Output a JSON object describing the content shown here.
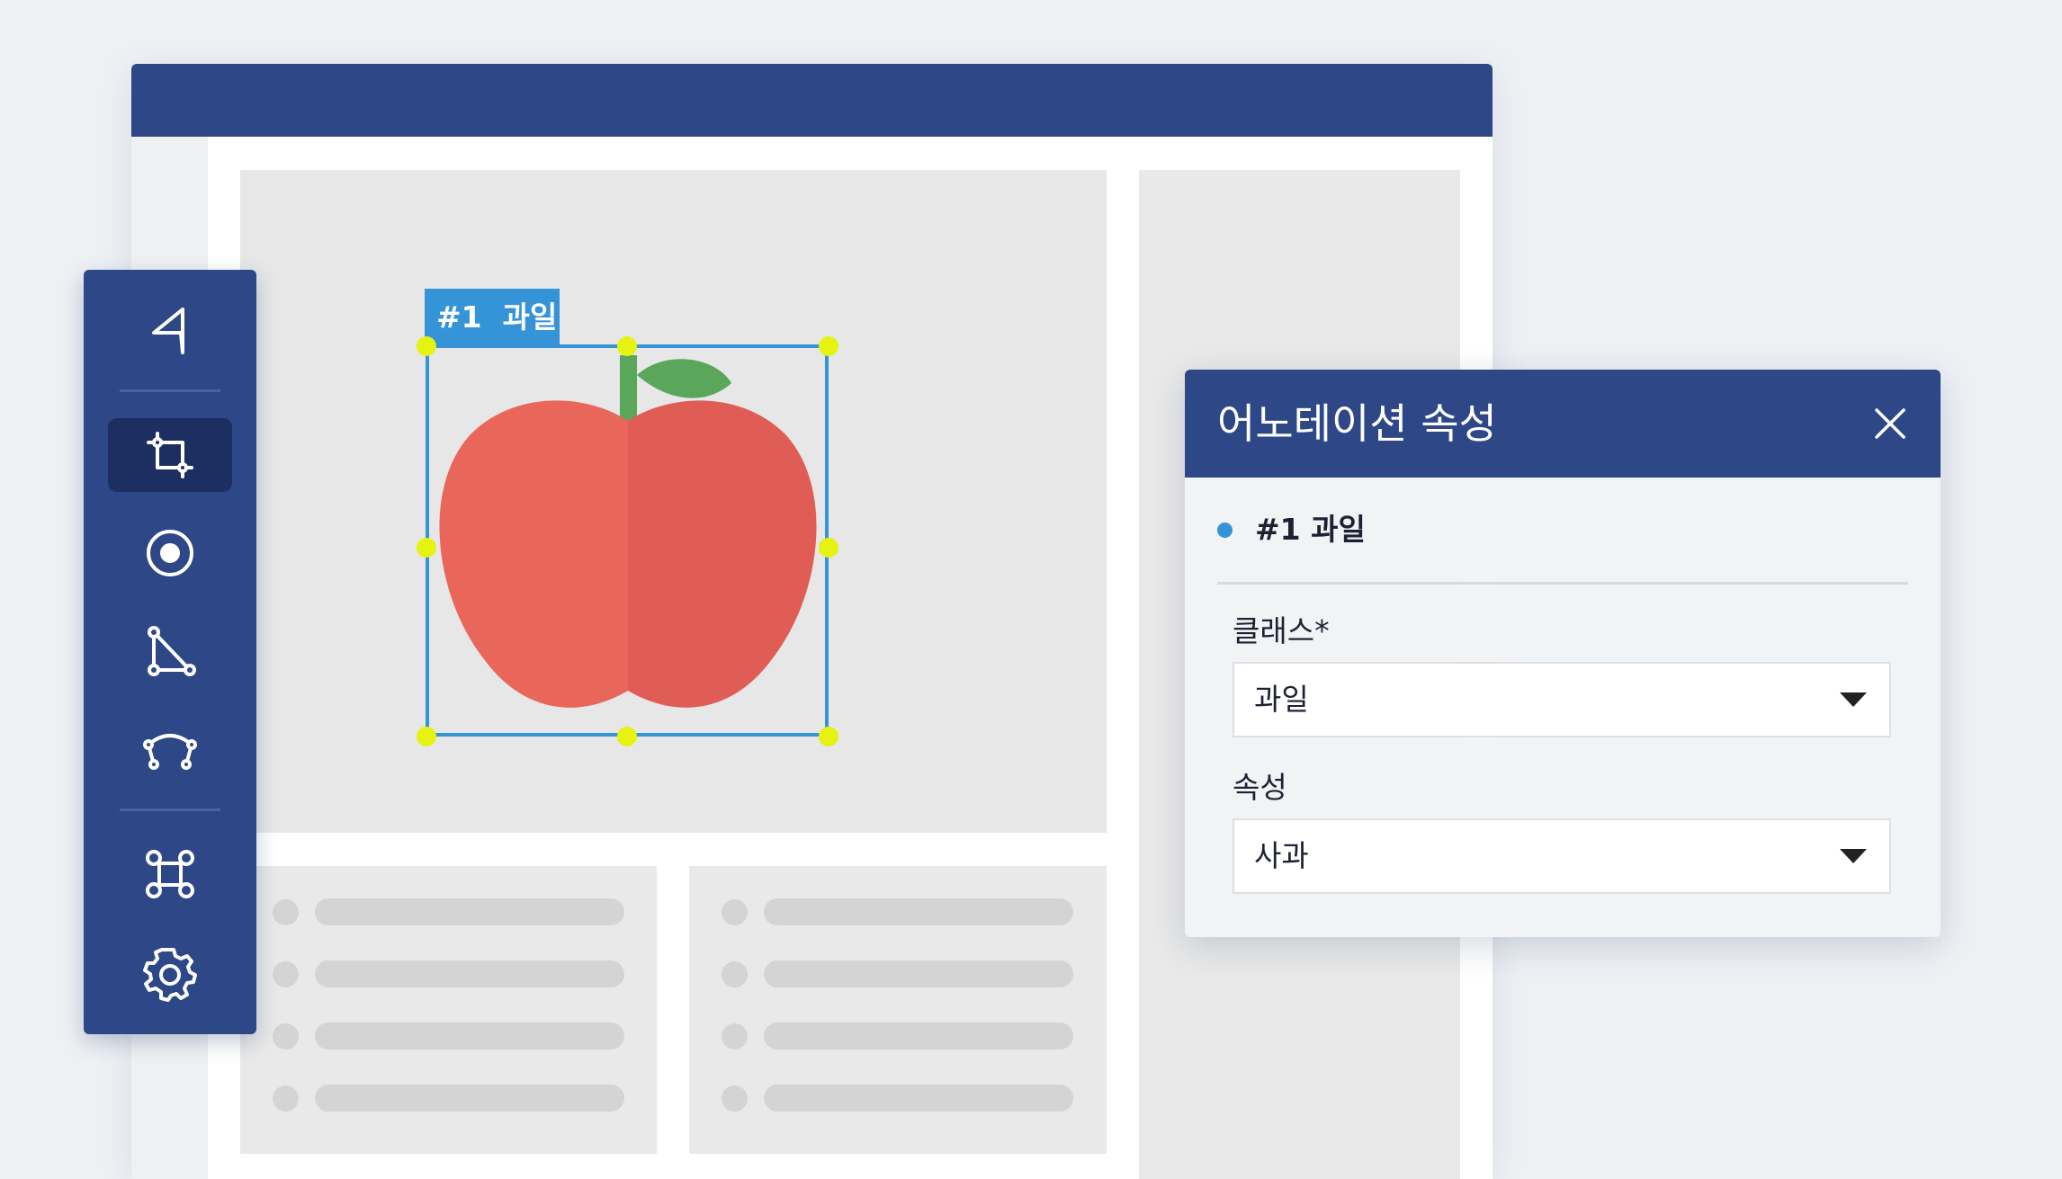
{
  "annotation": {
    "label": "#1  과일",
    "colors": {
      "box": "#3593d8",
      "handle": "#e6f20f"
    }
  },
  "toolbar": {
    "tools": [
      {
        "icon": "pointer-icon"
      },
      {
        "icon": "bounding-box-icon",
        "active": true
      },
      {
        "icon": "keypoint-icon"
      },
      {
        "icon": "polygon-icon"
      },
      {
        "icon": "polyline-icon"
      },
      {
        "icon": "command-icon"
      },
      {
        "icon": "gear-icon"
      }
    ]
  },
  "dialog": {
    "title": "어노테이션 속성",
    "annotation_name": "#1 과일",
    "class_label": "클래스*",
    "class_value": "과일",
    "attribute_label": "속성",
    "attribute_value": "사과"
  },
  "theme": {
    "primary": "#2e4786",
    "active_tool": "#1d2e61"
  }
}
